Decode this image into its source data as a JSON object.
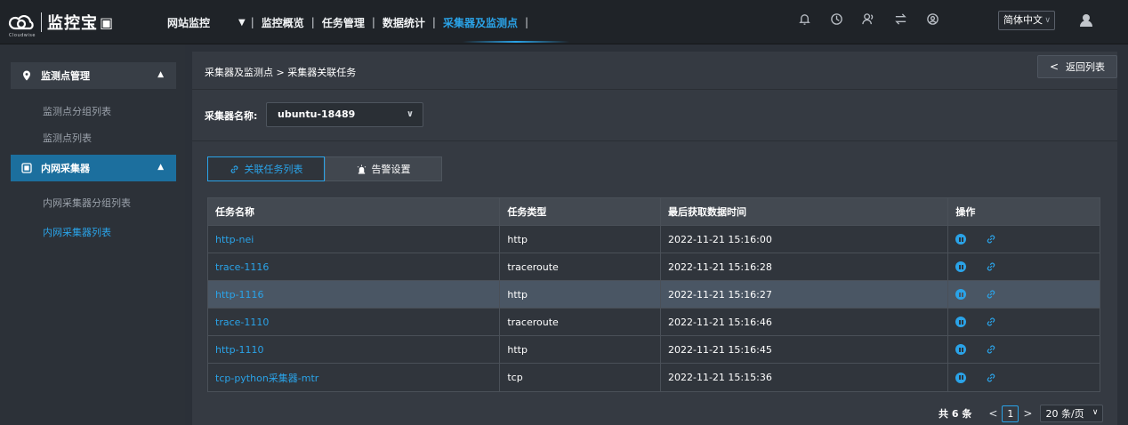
{
  "header": {
    "logo_text": "监控宝",
    "logo_sub": "Cloudwise",
    "nav": {
      "site_monitor": "网站监控",
      "items": [
        "监控概览",
        "任务管理",
        "数据统计"
      ],
      "active": "采集器及监测点"
    },
    "language": "简体中文"
  },
  "icons": {
    "bell": "bell-icon",
    "history": "clock-icon",
    "users": "users-icon",
    "switch": "switch-icon",
    "account": "account-circle-icon",
    "avatar": "avatar-icon"
  },
  "sidebar": {
    "groups": [
      {
        "label": "监测点管理",
        "items": [
          "监测点分组列表",
          "监测点列表"
        ]
      },
      {
        "label": "内网采集器",
        "items": [
          "内网采集器分组列表",
          "内网采集器列表"
        ]
      }
    ]
  },
  "main": {
    "breadcrumb": "采集器及监测点 > 采集器关联任务",
    "back_button": "返回列表",
    "filter_label": "采集器名称:",
    "collector_selected": "ubuntu-18489",
    "tabs": {
      "task_list": "关联任务列表",
      "alert_settings": "告警设置"
    },
    "table": {
      "columns": [
        "任务名称",
        "任务类型",
        "最后获取数据时间",
        "操作"
      ],
      "rows": [
        {
          "name": "http-nei",
          "type": "http",
          "time": "2022-11-21 15:16:00"
        },
        {
          "name": "trace-1116",
          "type": "traceroute",
          "time": "2022-11-21 15:16:28"
        },
        {
          "name": "http-1116",
          "type": "http",
          "time": "2022-11-21 15:16:27"
        },
        {
          "name": "trace-1110",
          "type": "traceroute",
          "time": "2022-11-21 15:16:46"
        },
        {
          "name": "http-1110",
          "type": "http",
          "time": "2022-11-21 15:16:45"
        },
        {
          "name": "tcp-python采集器-mtr",
          "type": "tcp",
          "time": "2022-11-21 15:15:36"
        }
      ]
    },
    "pagination": {
      "total": "共 6 条",
      "current_page": "1",
      "page_size": "20 条/页"
    }
  },
  "colors": {
    "accent": "#2aa3e8",
    "topbar_bg": "#1f2328",
    "sidebar_active_bg": "#1c6f9e",
    "row_highlight": "#4a5664"
  }
}
